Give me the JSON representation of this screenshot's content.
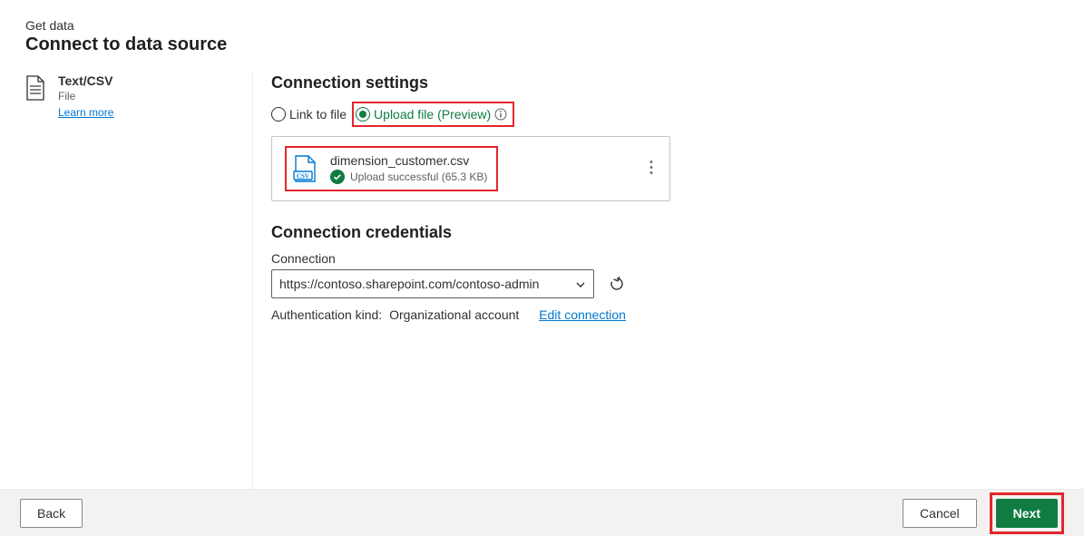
{
  "header": {
    "breadcrumb": "Get data",
    "title": "Connect to data source"
  },
  "source": {
    "name": "Text/CSV",
    "type": "File",
    "learn_more": "Learn more"
  },
  "settings": {
    "heading": "Connection settings",
    "radios": {
      "link": "Link to file",
      "upload": "Upload file (Preview)"
    },
    "file": {
      "name": "dimension_customer.csv",
      "status": "Upload successful (65.3 KB)"
    }
  },
  "credentials": {
    "heading": "Connection credentials",
    "connection_label": "Connection",
    "connection_value": "https://contoso.sharepoint.com/contoso-admin",
    "auth_label": "Authentication kind:",
    "auth_value": "Organizational account",
    "edit_link": "Edit connection"
  },
  "footer": {
    "back": "Back",
    "cancel": "Cancel",
    "next": "Next"
  }
}
